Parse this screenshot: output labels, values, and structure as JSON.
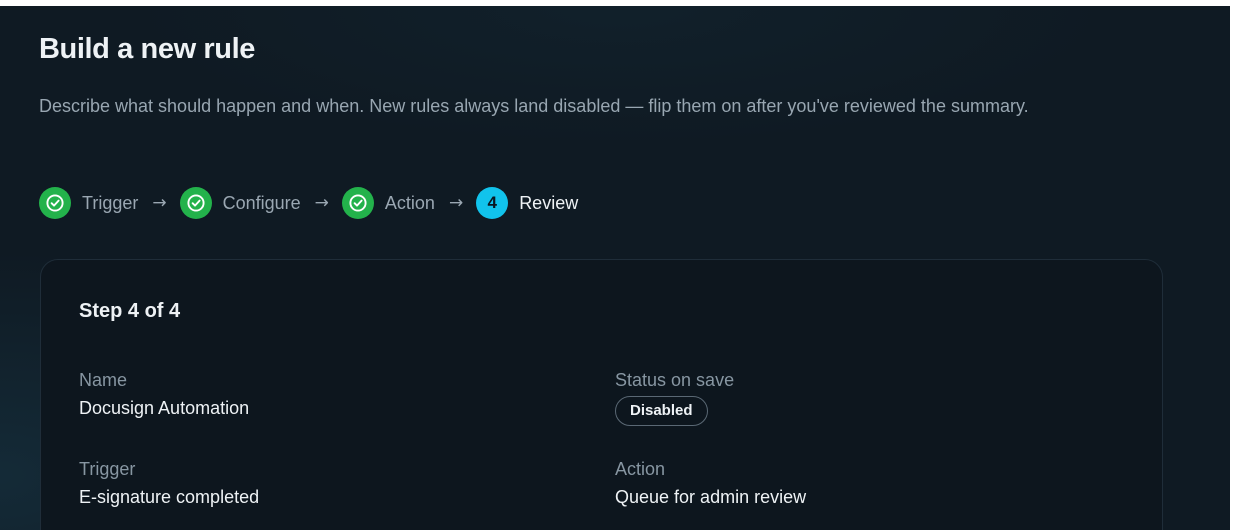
{
  "page": {
    "title": "Build a new rule",
    "description": "Describe what should happen and when. New rules always land disabled — flip them on after you've reviewed the summary."
  },
  "stepper": {
    "arrow": "→",
    "steps": [
      {
        "label": "Trigger",
        "state": "complete",
        "icon": "check-circle-icon"
      },
      {
        "label": "Configure",
        "state": "complete",
        "icon": "check-circle-icon"
      },
      {
        "label": "Action",
        "state": "complete",
        "icon": "check-circle-icon"
      },
      {
        "label": "Review",
        "state": "current",
        "number": "4"
      }
    ]
  },
  "review": {
    "heading": "Step 4 of 4",
    "fields": {
      "name": {
        "label": "Name",
        "value": "Docusign Automation"
      },
      "status": {
        "label": "Status on save",
        "value": "Disabled"
      },
      "trigger": {
        "label": "Trigger",
        "value": "E-signature completed"
      },
      "action": {
        "label": "Action",
        "value": "Queue for admin review"
      }
    }
  },
  "colors": {
    "background": "#0f1a23",
    "card": "#0d161e",
    "complete": "#23b24b",
    "current": "#11c3ec",
    "text_primary": "#eef2f5",
    "text_muted": "#98a6b1"
  }
}
